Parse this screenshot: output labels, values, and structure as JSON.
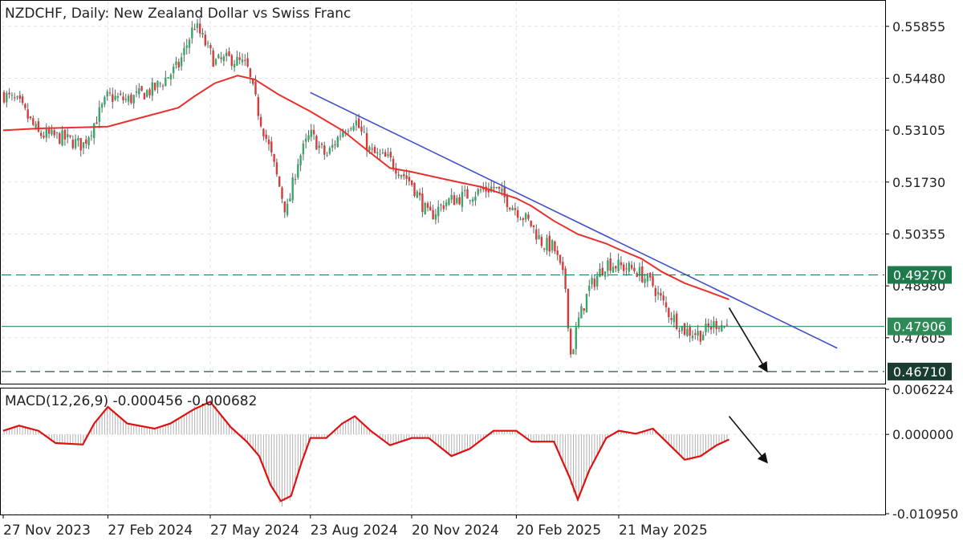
{
  "chart_data": [
    {
      "type": "line",
      "title": "NZDCHF, Daily:  New Zealand Dollar vs Swiss Franc",
      "subtype": "candlestick-ohlc",
      "ylim": [
        0.4641,
        0.5651
      ],
      "y_ticks": [
        "0.55855",
        "0.54480",
        "0.53105",
        "0.51730",
        "0.50355",
        "0.48980",
        "0.47605"
      ],
      "x_ticks": [
        "27 Nov 2023",
        "27 Feb 2024",
        "27 May 2024",
        "23 Aug 2024",
        "20 Nov 2024",
        "20 Feb 2025",
        "21 May 2025"
      ],
      "grid": true,
      "price_close_path": [
        {
          "x": "27 Nov 2023",
          "y": 0.5405
        },
        {
          "x": "11 Dec 2023",
          "y": 0.538
        },
        {
          "x": "28 Dec 2023",
          "y": 0.53
        },
        {
          "x": "18 Jan 2024",
          "y": 0.529
        },
        {
          "x": "5 Feb 2024",
          "y": 0.527
        },
        {
          "x": "27 Feb 2024",
          "y": 0.54
        },
        {
          "x": "15 Mar 2024",
          "y": 0.539
        },
        {
          "x": "8 Apr 2024",
          "y": 0.542
        },
        {
          "x": "29 Apr 2024",
          "y": 0.548
        },
        {
          "x": "13 May 2024",
          "y": 0.559
        },
        {
          "x": "20 May 2024",
          "y": 0.5555
        },
        {
          "x": "31 May 2024",
          "y": 0.549
        },
        {
          "x": "14 Jun 2024",
          "y": 0.55
        },
        {
          "x": "28 Jun 2024",
          "y": 0.548
        },
        {
          "x": "9 Jul 2024",
          "y": 0.535
        },
        {
          "x": "19 Jul 2024",
          "y": 0.525
        },
        {
          "x": "26 Jul 2024",
          "y": 0.517
        },
        {
          "x": "2 Aug 2024",
          "y": 0.509
        },
        {
          "x": "12 Aug 2024",
          "y": 0.523
        },
        {
          "x": "23 Aug 2024",
          "y": 0.53
        },
        {
          "x": "6 Sep 2024",
          "y": 0.524
        },
        {
          "x": "20 Sep 2024",
          "y": 0.531
        },
        {
          "x": "1 Oct 2024",
          "y": 0.534
        },
        {
          "x": "15 Oct 2024",
          "y": 0.525
        },
        {
          "x": "1 Nov 2024",
          "y": 0.523
        },
        {
          "x": "20 Nov 2024",
          "y": 0.517
        },
        {
          "x": "5 Dec 2024",
          "y": 0.508
        },
        {
          "x": "20 Dec 2024",
          "y": 0.512
        },
        {
          "x": "10 Jan 2025",
          "y": 0.514
        },
        {
          "x": "31 Jan 2025",
          "y": 0.516
        },
        {
          "x": "20 Feb 2025",
          "y": 0.51
        },
        {
          "x": "5 Mar 2025",
          "y": 0.506
        },
        {
          "x": "15 Mar 2025",
          "y": 0.501
        },
        {
          "x": "25 Mar 2025",
          "y": 0.5
        },
        {
          "x": "4 Apr 2025",
          "y": 0.49
        },
        {
          "x": "9 Apr 2025",
          "y": 0.471
        },
        {
          "x": "15 Apr 2025",
          "y": 0.48
        },
        {
          "x": "25 Apr 2025",
          "y": 0.489
        },
        {
          "x": "10 May 2025",
          "y": 0.496
        },
        {
          "x": "21 May 2025",
          "y": 0.495
        },
        {
          "x": "5 Jun 2025",
          "y": 0.494
        },
        {
          "x": "20 Jun 2025",
          "y": 0.49
        },
        {
          "x": "3 Jul 2025",
          "y": 0.483
        },
        {
          "x": "18 Jul 2025",
          "y": 0.478
        },
        {
          "x": "1 Aug 2025",
          "y": 0.477
        },
        {
          "x": "15 Aug 2025",
          "y": 0.48
        },
        {
          "x": "26 Aug 2025",
          "y": 0.479
        }
      ],
      "moving_average": {
        "color": "#e8302c",
        "points": [
          {
            "x": "27 Nov 2023",
            "y": 0.531
          },
          {
            "x": "28 Dec 2023",
            "y": 0.5315
          },
          {
            "x": "5 Feb 2024",
            "y": 0.5318
          },
          {
            "x": "27 Feb 2024",
            "y": 0.532
          },
          {
            "x": "29 Mar 2024",
            "y": 0.5345
          },
          {
            "x": "29 Apr 2024",
            "y": 0.537
          },
          {
            "x": "13 May 2024",
            "y": 0.54
          },
          {
            "x": "31 May 2024",
            "y": 0.5435
          },
          {
            "x": "20 Jun 2024",
            "y": 0.5455
          },
          {
            "x": "5 Jul 2024",
            "y": 0.5445
          },
          {
            "x": "26 Jul 2024",
            "y": 0.5405
          },
          {
            "x": "23 Aug 2024",
            "y": 0.536
          },
          {
            "x": "20 Sep 2024",
            "y": 0.531
          },
          {
            "x": "15 Oct 2024",
            "y": 0.525
          },
          {
            "x": "1 Nov 2024",
            "y": 0.521
          },
          {
            "x": "20 Nov 2024",
            "y": 0.52
          },
          {
            "x": "20 Dec 2024",
            "y": 0.518
          },
          {
            "x": "20 Jan 2025",
            "y": 0.516
          },
          {
            "x": "20 Feb 2025",
            "y": 0.513
          },
          {
            "x": "5 Mar 2025",
            "y": 0.511
          },
          {
            "x": "25 Mar 2025",
            "y": 0.507
          },
          {
            "x": "15 Apr 2025",
            "y": 0.5035
          },
          {
            "x": "10 May 2025",
            "y": 0.501
          },
          {
            "x": "21 May 2025",
            "y": 0.4995
          },
          {
            "x": "10 Jun 2025",
            "y": 0.497
          },
          {
            "x": "28 Jun 2025",
            "y": 0.4935
          },
          {
            "x": "18 Jul 2025",
            "y": 0.4905
          },
          {
            "x": "10 Aug 2025",
            "y": 0.488
          },
          {
            "x": "26 Aug 2025",
            "y": 0.4862
          }
        ]
      },
      "trendline": {
        "color": "#4050c8",
        "start": {
          "x": "23 Aug 2024",
          "y": 0.541
        },
        "end": {
          "x": "29 Nov 2025",
          "y": 0.4733
        }
      },
      "levels": [
        {
          "label": "0.49270",
          "value": 0.4927,
          "style": "dashed",
          "color": "#1e7a4a"
        },
        {
          "label": "0.47906",
          "value": 0.47906,
          "style": "solid",
          "color": "#2e8b57"
        },
        {
          "label": "0.46710",
          "value": 0.4671,
          "style": "dashed",
          "color": "#1a3d30"
        }
      ],
      "annotations": [
        {
          "type": "arrow",
          "direction": "down",
          "from": {
            "x": "26 Aug 2025",
            "y": 0.484
          },
          "to": {
            "x": "28 Sep 2025",
            "y": 0.4673
          }
        }
      ],
      "colors": {
        "bull": "#3aa66a",
        "bear": "#d93a3a",
        "wick": "#555555"
      }
    },
    {
      "type": "bar",
      "title": "MACD(12,26,9) -0.000456 -0.000682",
      "ylim": [
        -0.01095,
        0.006224
      ],
      "y_ticks": [
        "0.006224",
        "0.000000",
        "-0.010950"
      ],
      "histogram_color": "#b0b0b0",
      "signal_color": "#e01010",
      "signal": [
        {
          "x": "27 Nov 2023",
          "y": 0.0005
        },
        {
          "x": "11 Dec 2023",
          "y": 0.0012
        },
        {
          "x": "28 Dec 2023",
          "y": 0.0005
        },
        {
          "x": "12 Jan 2024",
          "y": -0.0012
        },
        {
          "x": "5 Feb 2024",
          "y": -0.0014
        },
        {
          "x": "15 Feb 2024",
          "y": 0.0015
        },
        {
          "x": "27 Feb 2024",
          "y": 0.0038
        },
        {
          "x": "15 Mar 2024",
          "y": 0.0015
        },
        {
          "x": "8 Apr 2024",
          "y": 0.0008
        },
        {
          "x": "22 Apr 2024",
          "y": 0.0015
        },
        {
          "x": "13 May 2024",
          "y": 0.0035
        },
        {
          "x": "27 May 2024",
          "y": 0.0045
        },
        {
          "x": "14 Jun 2024",
          "y": 0.001
        },
        {
          "x": "28 Jun 2024",
          "y": -0.001
        },
        {
          "x": "9 Jul 2024",
          "y": -0.003
        },
        {
          "x": "19 Jul 2024",
          "y": -0.007
        },
        {
          "x": "28 Jul 2024",
          "y": -0.0092
        },
        {
          "x": "6 Aug 2024",
          "y": -0.0085
        },
        {
          "x": "15 Aug 2024",
          "y": -0.004
        },
        {
          "x": "23 Aug 2024",
          "y": -0.0005
        },
        {
          "x": "6 Sep 2024",
          "y": -0.0005
        },
        {
          "x": "20 Sep 2024",
          "y": 0.0015
        },
        {
          "x": "1 Oct 2024",
          "y": 0.0025
        },
        {
          "x": "15 Oct 2024",
          "y": 0.0005
        },
        {
          "x": "1 Nov 2024",
          "y": -0.0015
        },
        {
          "x": "20 Nov 2024",
          "y": -0.0005
        },
        {
          "x": "5 Dec 2024",
          "y": -0.0005
        },
        {
          "x": "25 Dec 2024",
          "y": -0.003
        },
        {
          "x": "10 Jan 2025",
          "y": -0.002
        },
        {
          "x": "31 Jan 2025",
          "y": 0.0005
        },
        {
          "x": "20 Feb 2025",
          "y": 0.0005
        },
        {
          "x": "5 Mar 2025",
          "y": -0.001
        },
        {
          "x": "25 Mar 2025",
          "y": -0.001
        },
        {
          "x": "8 Apr 2025",
          "y": -0.006
        },
        {
          "x": "15 Apr 2025",
          "y": -0.009
        },
        {
          "x": "25 Apr 2025",
          "y": -0.005
        },
        {
          "x": "10 May 2025",
          "y": -0.0005
        },
        {
          "x": "21 May 2025",
          "y": 0.0005
        },
        {
          "x": "5 Jun 2025",
          "y": 0.0001
        },
        {
          "x": "20 Jun 2025",
          "y": 0.0008
        },
        {
          "x": "5 Jul 2025",
          "y": -0.0015
        },
        {
          "x": "18 Jul 2025",
          "y": -0.0035
        },
        {
          "x": "1 Aug 2025",
          "y": -0.003
        },
        {
          "x": "15 Aug 2025",
          "y": -0.0015
        },
        {
          "x": "26 Aug 2025",
          "y": -0.0007
        }
      ],
      "annotations": [
        {
          "type": "arrow",
          "direction": "down",
          "color": "#000000"
        }
      ]
    }
  ]
}
